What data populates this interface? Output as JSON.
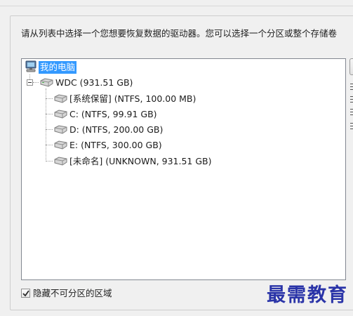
{
  "instruction": "请从列表中选择一个您想要恢复数据的驱动器。您可以选择一个分区或整个存储卷",
  "tree": {
    "root": {
      "label": "我的电脑",
      "icon": "computer-icon"
    },
    "disk": {
      "label": "WDC (931.51 GB)",
      "icon": "disk-drive-icon",
      "expanded": true
    },
    "partitions": [
      {
        "label": "[系统保留] (NTFS, 100.00 MB)",
        "icon": "partition-icon"
      },
      {
        "label": "C: (NTFS, 99.91 GB)",
        "icon": "partition-icon"
      },
      {
        "label": "D: (NTFS, 200.00 GB)",
        "icon": "partition-icon"
      },
      {
        "label": "E: (NTFS, 300.00 GB)",
        "icon": "partition-icon"
      },
      {
        "label": "[未命名] (UNKNOWN, 931.51 GB)",
        "icon": "partition-icon"
      }
    ]
  },
  "hide_unpartitioned": {
    "label": "隐藏不可分区的区域",
    "checked": true
  },
  "watermark": "最需教育",
  "colors": {
    "selection": "#3399ff",
    "watermark": "#2a34a8",
    "background": "#f0f0f0"
  }
}
